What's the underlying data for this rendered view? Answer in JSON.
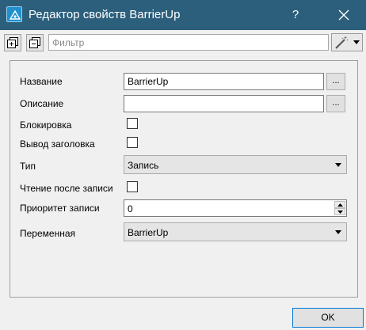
{
  "window": {
    "title": "Редактор свойств BarrierUp",
    "help_label": "?"
  },
  "toolbar": {
    "filter_placeholder": "Фильтр",
    "filter_value": ""
  },
  "properties": {
    "name_label": "Название",
    "name_value": "BarrierUp",
    "description_label": "Описание",
    "description_value": "",
    "lock_label": "Блокировка",
    "lock_checked": false,
    "show_header_label": "Вывод заголовка",
    "show_header_checked": false,
    "type_label": "Тип",
    "type_value": "Запись",
    "read_after_write_label": "Чтение после записи",
    "read_after_write_checked": false,
    "write_priority_label": "Приоритет записи",
    "write_priority_value": "0",
    "variable_label": "Переменная",
    "variable_value": "BarrierUp",
    "dots_label": "..."
  },
  "footer": {
    "ok_label": "OK"
  },
  "colors": {
    "titlebar": "#2b5f7c",
    "accent": "#0078d7"
  }
}
